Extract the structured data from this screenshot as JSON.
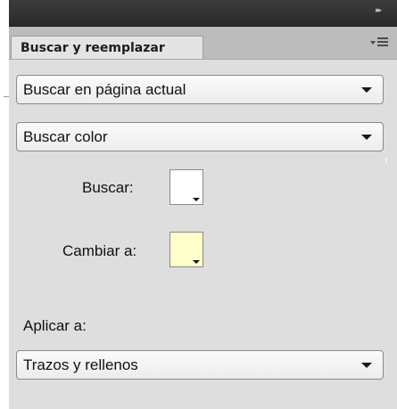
{
  "panel": {
    "tab_label": "Buscar y reemplazar",
    "collapse_icon": "double-chevron-right-icon",
    "menu_icon": "panel-menu-icon"
  },
  "search_scope": {
    "selected": "Buscar en página actual"
  },
  "search_type": {
    "selected": "Buscar color"
  },
  "find_color": {
    "label": "Buscar:",
    "color": "#ffffff"
  },
  "replace_color": {
    "label": "Cambiar a:",
    "color": "#ffffcc"
  },
  "apply_to": {
    "label": "Aplicar a:",
    "selected": "Trazos y rellenos"
  },
  "colors": {
    "panel_bg": "#dedede",
    "titlebar": "#333333",
    "tab_bg": "#e4e4e4"
  }
}
